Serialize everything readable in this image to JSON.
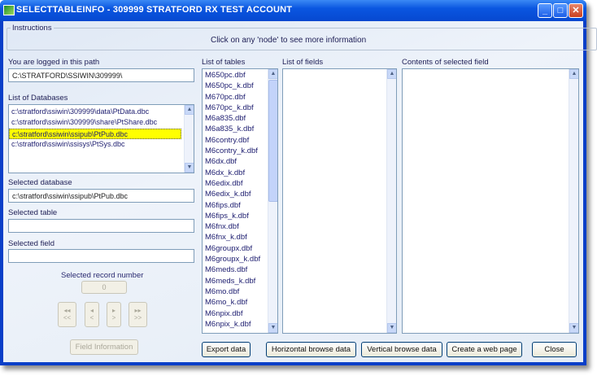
{
  "window": {
    "title": "SELECTTABLEINFO - 309999 STRATFORD RX TEST ACCOUNT",
    "minimize": "_",
    "maximize": "□",
    "close": "✕"
  },
  "instructions": {
    "label": "Instructions",
    "text": "Click on any 'node' to see more information"
  },
  "path": {
    "label": "You are logged in this path",
    "value": "C:\\STRATFORD\\SSIWIN\\309999\\"
  },
  "databases": {
    "label": "List of Databases",
    "items": [
      "c:\\stratford\\ssiwin\\309999\\data\\PtData.dbc",
      "c:\\stratford\\ssiwin\\309999\\share\\PtShare.dbc",
      "c:\\stratford\\ssiwin\\ssipub\\PtPub.dbc",
      "c:\\stratford\\ssiwin\\ssisys\\PtSys.dbc"
    ],
    "selected_index": 2
  },
  "selected_database": {
    "label": "Selected database",
    "value": "c:\\stratford\\ssiwin\\ssipub\\PtPub.dbc"
  },
  "selected_table": {
    "label": "Selected table",
    "value": ""
  },
  "selected_field": {
    "label": "Selected field",
    "value": ""
  },
  "record": {
    "label": "Selected record number",
    "value": "0"
  },
  "nav": [
    {
      "icon": "◂◂",
      "text": "<<"
    },
    {
      "icon": "◂",
      "text": "<"
    },
    {
      "icon": "▸",
      "text": ">"
    },
    {
      "icon": "▸▸",
      "text": ">>"
    }
  ],
  "field_info_button": "Field Information",
  "tables": {
    "label": "List of tables",
    "items": [
      "M650pc.dbf",
      "M650pc_k.dbf",
      "M670pc.dbf",
      "M670pc_k.dbf",
      "M6a835.dbf",
      "M6a835_k.dbf",
      "M6contry.dbf",
      "M6contry_k.dbf",
      "M6dx.dbf",
      "M6dx_k.dbf",
      "M6edix.dbf",
      "M6edix_k.dbf",
      "M6fips.dbf",
      "M6fips_k.dbf",
      "M6fnx.dbf",
      "M6fnx_k.dbf",
      "M6groupx.dbf",
      "M6groupx_k.dbf",
      "M6meds.dbf",
      "M6meds_k.dbf",
      "M6mo.dbf",
      "M6mo_k.dbf",
      "M6npix.dbf",
      "M6npix_k.dbf"
    ]
  },
  "fields": {
    "label": "List of fields"
  },
  "contents": {
    "label": "Contents of selected field"
  },
  "buttons": {
    "export": "Export data",
    "horizontal": "Horizontal browse data",
    "vertical": "Vertical browse data",
    "web": "Create a web page",
    "close": "Close"
  }
}
